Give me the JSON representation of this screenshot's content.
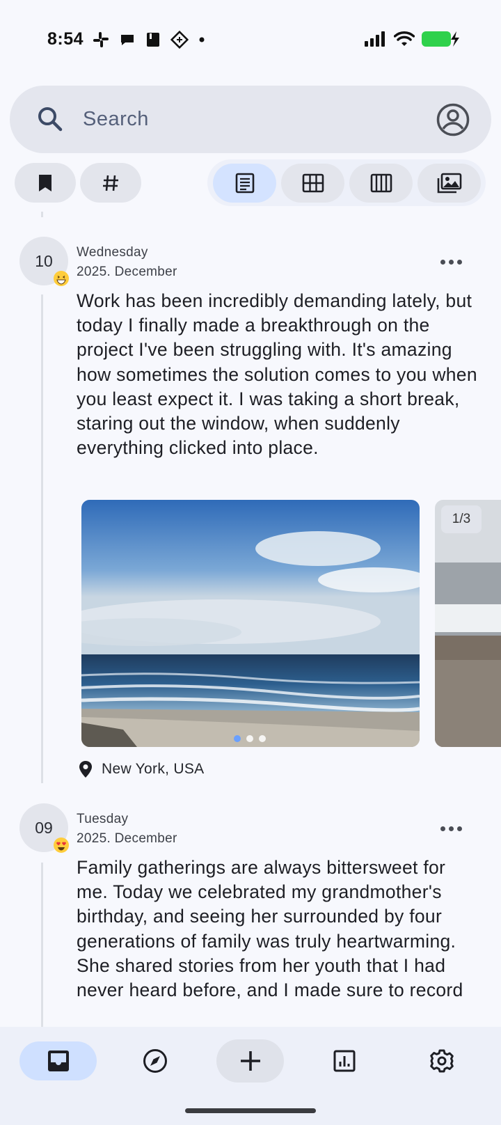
{
  "status_bar": {
    "time": "8:54",
    "app_icons": [
      "slack-icon",
      "chat-bubble-icon",
      "book-icon",
      "sync-app-icon",
      "dot-indicator"
    ],
    "system_icons": [
      "signal-icon",
      "wifi-icon",
      "battery-charging-icon"
    ]
  },
  "search": {
    "placeholder": "Search"
  },
  "filters": {
    "chips": [
      "bookmark-icon",
      "hashtag-icon"
    ],
    "view_modes": [
      "list-view-icon",
      "grid-view-icon",
      "columns-view-icon",
      "gallery-view-icon"
    ],
    "active_view": "list-view-icon"
  },
  "entries": [
    {
      "day": "10",
      "weekday": "Wednesday",
      "month": "2025. December",
      "mood": "grinning-face-icon",
      "text": "Work has been incredibly demanding lately, but today I finally made a breakthrough on the project I've been struggling with. It's amazing how sometimes the solution comes to you when you least expect it. I was taking a short break, staring out the window, when suddenly everything clicked into place.",
      "photos": {
        "counter": "1/3",
        "total": 3,
        "active_index": 0
      },
      "location": "New York, USA"
    },
    {
      "day": "09",
      "weekday": "Tuesday",
      "month": "2025. December",
      "mood": "heart-eyes-face-icon",
      "text": "Family gatherings are always bittersweet for me. Today we celebrated my grandmother's birthday, and seeing her surrounded by four generations of family was truly heartwarming. She shared stories from her youth that I had never heard before, and I made sure to record"
    }
  ],
  "bottom_nav": {
    "items": [
      "journal-inbox-icon",
      "explore-compass-icon",
      "add-icon",
      "stats-icon",
      "settings-gear-icon"
    ],
    "active": "journal-inbox-icon"
  },
  "colors": {
    "background": "#f7f8fd",
    "accent": "#d4e3ff",
    "chip": "#e3e5ec"
  }
}
